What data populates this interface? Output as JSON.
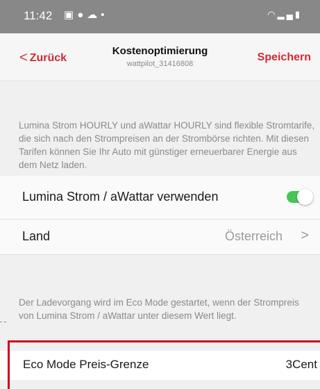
{
  "status_bar": {
    "time": "11:42",
    "left_icons": [
      "image-icon",
      "chat-icon",
      "cloud-icon",
      "dot-icon"
    ],
    "right_icons": [
      "wifi-icon",
      "signal-icon",
      "battery-icon"
    ]
  },
  "nav": {
    "back_label": "Zurück",
    "title": "Kostenoptimierung",
    "subtitle": "wattpilot_31416808",
    "save_label": "Speichern"
  },
  "section1": {
    "description": "Lumina Strom HOURLY und aWattar HOURLY sind flexible Stromtarife, die sich nach den Strompreisen an der Strombörse richten. Mit diesen Tarifen können Sie Ihr Auto mit günstiger erneuerbarer Energie aus dem Netz laden.",
    "toggle_label": "Lumina Strom / aWattar verwenden",
    "toggle_on": true,
    "country_label": "Land",
    "country_value": "Österreich",
    "chevron": ">"
  },
  "section2": {
    "description": "Der Ladevorgang wird im Eco Mode gestartet, wenn der Strompreis von Lumina Strom / aWattar unter diesem Wert liegt.",
    "threshold_label": "Eco Mode Preis-Grenze",
    "threshold_value": "3Cent"
  },
  "colors": {
    "accent": "#d22a36",
    "toggle_on": "#47c457",
    "highlight": "#d0021b"
  }
}
